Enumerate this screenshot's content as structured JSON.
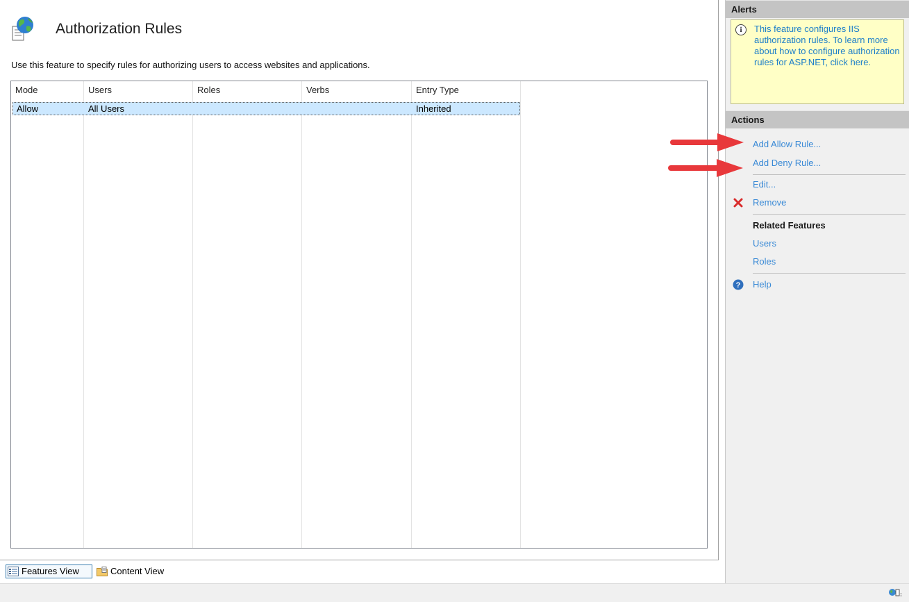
{
  "header": {
    "title": "Authorization Rules",
    "description": "Use this feature to specify rules for authorizing users to access websites and applications."
  },
  "grid": {
    "columns": [
      "Mode",
      "Users",
      "Roles",
      "Verbs",
      "Entry Type"
    ],
    "rows": [
      {
        "mode": "Allow",
        "users": "All Users",
        "roles": "",
        "verbs": "",
        "entry_type": "Inherited"
      }
    ]
  },
  "view_tabs": {
    "features_view": "Features View",
    "content_view": "Content View"
  },
  "alerts": {
    "title": "Alerts",
    "message": "This feature configures IIS authorization rules. To learn more about how to configure authorization rules for ASP.NET, click here."
  },
  "actions": {
    "title": "Actions",
    "add_allow": "Add Allow Rule...",
    "add_deny": "Add Deny Rule...",
    "edit": "Edit...",
    "remove": "Remove",
    "related_features": "Related Features",
    "users": "Users",
    "roles": "Roles",
    "help": "Help"
  },
  "colors": {
    "link": "#3a8ad6",
    "selection": "#cce8ff",
    "alert_bg": "#ffffc6",
    "section_header": "#c4c4c4",
    "annotation_arrow": "#e8383b"
  },
  "icons": {
    "page": "globe-document-icon",
    "alert": "info-icon",
    "remove": "red-x-icon",
    "help": "help-icon"
  }
}
